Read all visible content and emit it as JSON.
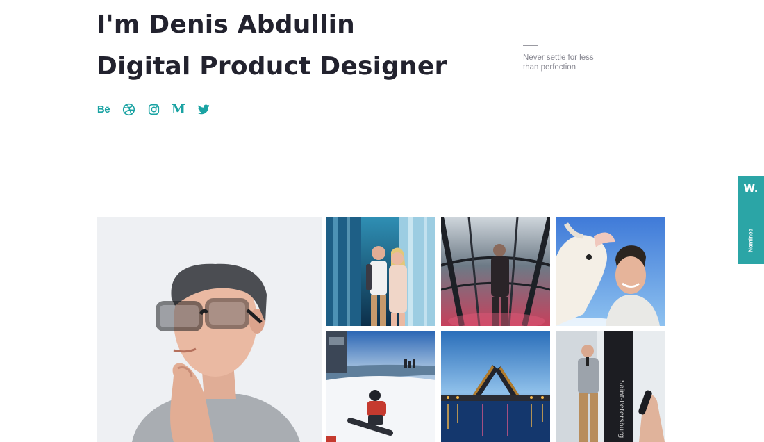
{
  "hero": {
    "line1": "I'm Denis Abdullin",
    "line2": "Digital Product Designer"
  },
  "tagline": {
    "line1": "Never settle for less",
    "line2": "than perfection"
  },
  "socials": [
    {
      "name": "behance",
      "glyph": "Bē",
      "icon": "behance-icon"
    },
    {
      "name": "dribbble",
      "icon": "dribbble-icon"
    },
    {
      "name": "instagram",
      "icon": "instagram-icon"
    },
    {
      "name": "medium",
      "glyph": "M",
      "icon": "medium-icon"
    },
    {
      "name": "twitter",
      "icon": "twitter-icon"
    }
  ],
  "badge": {
    "logo": "W.",
    "label": "Nominee"
  },
  "colors": {
    "accent": "#1aa3a3",
    "badge": "#2ba5a6",
    "heading": "#22222e",
    "muted": "#85858f"
  },
  "gallery": {
    "photos": [
      {
        "icon": "portrait-photo"
      },
      {
        "icon": "couple-skyscrapers-photo"
      },
      {
        "icon": "man-glass-dome-photo"
      },
      {
        "icon": "goat-selfie-photo"
      },
      {
        "icon": "snowboarder-photo"
      },
      {
        "icon": "drawbridge-night-photo"
      },
      {
        "icon": "speaker-conference-photo"
      }
    ]
  }
}
